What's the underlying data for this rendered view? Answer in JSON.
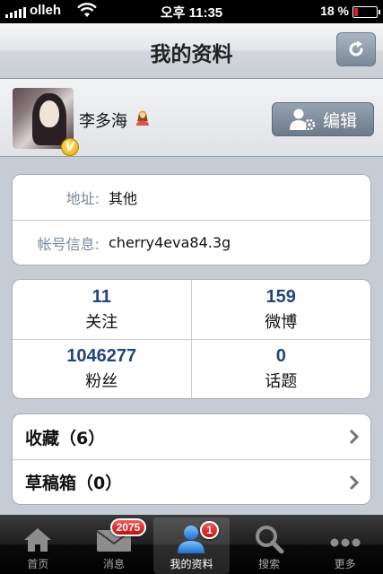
{
  "status_bar": {
    "carrier": "olleh",
    "time": "오후 11:35",
    "battery_percent": "18 %",
    "battery_level": 0.18,
    "battery_color": "#e02020"
  },
  "nav": {
    "title": "我的资料",
    "refresh_icon": "refresh-icon"
  },
  "profile": {
    "name": "李多海",
    "gender_icon": "female-user-icon",
    "vip_badge": "V",
    "edit_label": "编辑",
    "edit_icon": "user-settings-icon"
  },
  "info": [
    {
      "label": "地址:",
      "value": "其他"
    },
    {
      "label": "帐号信息:",
      "value": "cherry4eva84.3g"
    }
  ],
  "stats": [
    {
      "count": "11",
      "label": "关注"
    },
    {
      "count": "159",
      "label": "微博"
    },
    {
      "count": "1046277",
      "label": "粉丝"
    },
    {
      "count": "0",
      "label": "话题"
    }
  ],
  "links": [
    {
      "label": "收藏（6）"
    },
    {
      "label": "草稿箱（0）"
    }
  ],
  "tabs": [
    {
      "label": "首页",
      "icon": "home-icon",
      "badge": ""
    },
    {
      "label": "消息",
      "icon": "envelope-icon",
      "badge": "2075"
    },
    {
      "label": "我的资料",
      "icon": "profile-icon",
      "badge": "1"
    },
    {
      "label": "搜索",
      "icon": "search-icon",
      "badge": ""
    },
    {
      "label": "更多",
      "icon": "more-icon",
      "badge": ""
    }
  ],
  "colors": {
    "accent_number": "#23467a",
    "badge_red": "#c40e0e",
    "label_gray": "#7b8a9c"
  }
}
